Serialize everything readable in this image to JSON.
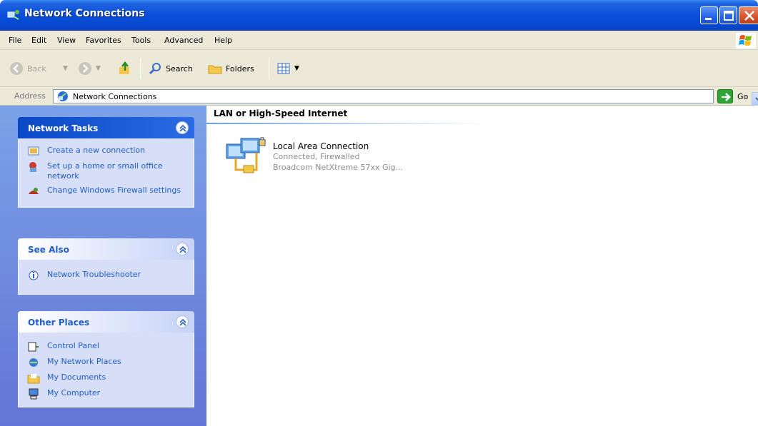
{
  "window": {
    "title": "Network Connections"
  },
  "menu": {
    "items": [
      "File",
      "Edit",
      "View",
      "Favorites",
      "Tools",
      "Advanced",
      "Help"
    ]
  },
  "toolbar": {
    "back": "Back",
    "search": "Search",
    "folders": "Folders"
  },
  "address": {
    "label": "Address",
    "value": "Network Connections",
    "go": "Go"
  },
  "tasks": {
    "network_tasks": {
      "title": "Network Tasks",
      "items": [
        "Create a new connection",
        "Set up a home or small office network",
        "Change Windows Firewall settings"
      ]
    },
    "see_also": {
      "title": "See Also",
      "items": [
        "Network Troubleshooter"
      ]
    },
    "other_places": {
      "title": "Other Places",
      "items": [
        "Control Panel",
        "My Network Places",
        "My Documents",
        "My Computer"
      ]
    }
  },
  "content": {
    "group": "LAN or High-Speed Internet",
    "connection": {
      "name": "Local Area Connection",
      "status": "Connected, Firewalled",
      "device": "Broadcom NetXtreme 57xx Gig..."
    }
  },
  "colors": {
    "titlebar": "#0a4fd8",
    "task_link": "#215dc6",
    "pane": "#6f8fe0"
  }
}
